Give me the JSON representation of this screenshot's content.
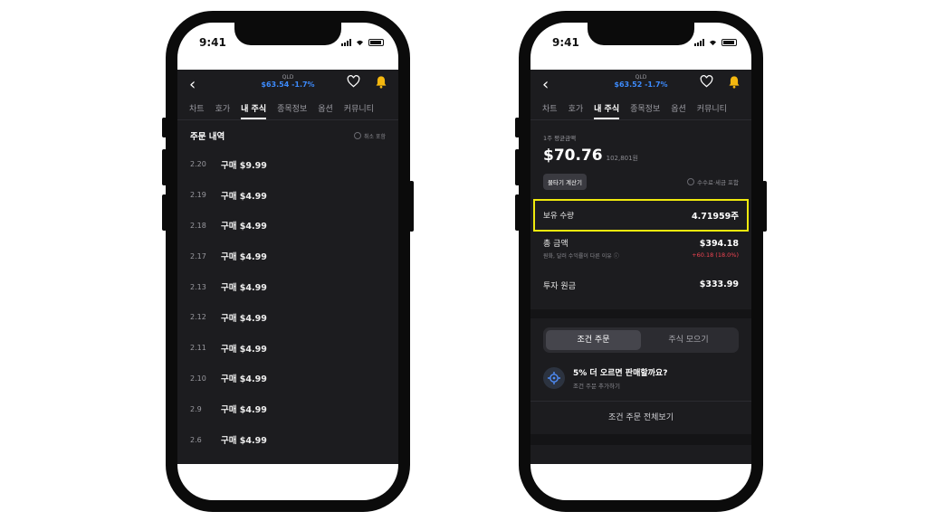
{
  "status": {
    "time": "9:41"
  },
  "header": {
    "left": {
      "symbol": "QLD",
      "price": "$63.54 -1.7%"
    },
    "right": {
      "symbol": "QLD",
      "price": "$63.52 -1.7%"
    }
  },
  "tabs": [
    {
      "label": "차트"
    },
    {
      "label": "호가"
    },
    {
      "label": "내 주식"
    },
    {
      "label": "종목정보"
    },
    {
      "label": "옵션"
    },
    {
      "label": "커뮤니티"
    }
  ],
  "orders": {
    "title": "주문 내역",
    "cancel_filter": "취소 포함",
    "rows": [
      {
        "date": "2.20",
        "desc": "구매 $9.99"
      },
      {
        "date": "2.19",
        "desc": "구매 $4.99"
      },
      {
        "date": "2.18",
        "desc": "구매 $4.99"
      },
      {
        "date": "2.17",
        "desc": "구매 $4.99"
      },
      {
        "date": "2.13",
        "desc": "구매 $4.99"
      },
      {
        "date": "2.12",
        "desc": "구매 $4.99"
      },
      {
        "date": "2.11",
        "desc": "구매 $4.99"
      },
      {
        "date": "2.10",
        "desc": "구매 $4.99"
      },
      {
        "date": "2.9",
        "desc": "구매 $4.99"
      },
      {
        "date": "2.6",
        "desc": "구매 $4.99"
      }
    ]
  },
  "holding": {
    "avg_label": "1주 평균금액",
    "avg_usd": "$70.76",
    "avg_krw": "102,801원",
    "calc_button": "물타기 계산기",
    "fee_note": "수수료·세금 포함",
    "qty_label": "보유 수량",
    "qty_value": "4.71959주",
    "total_label": "총 금액",
    "total_value": "$394.18",
    "total_note": "원화, 달러 수익률이 다른 이유",
    "total_gain": "+60.18 (18.0%)",
    "principal_label": "투자 원금",
    "principal_value": "$333.99"
  },
  "segment": {
    "options": [
      "조건 주문",
      "주식 모으기"
    ],
    "selected": "조건 주문"
  },
  "condition": {
    "title": "5% 더 오르면 판매할까요?",
    "subtitle": "조건 주문 추가하기",
    "view_all": "조건 주문 전체보기"
  },
  "colors": {
    "accent_blue": "#3d8bfd",
    "bell": "#f5b80f",
    "highlight": "#f0ea0d",
    "gain_red": "#f04452"
  }
}
